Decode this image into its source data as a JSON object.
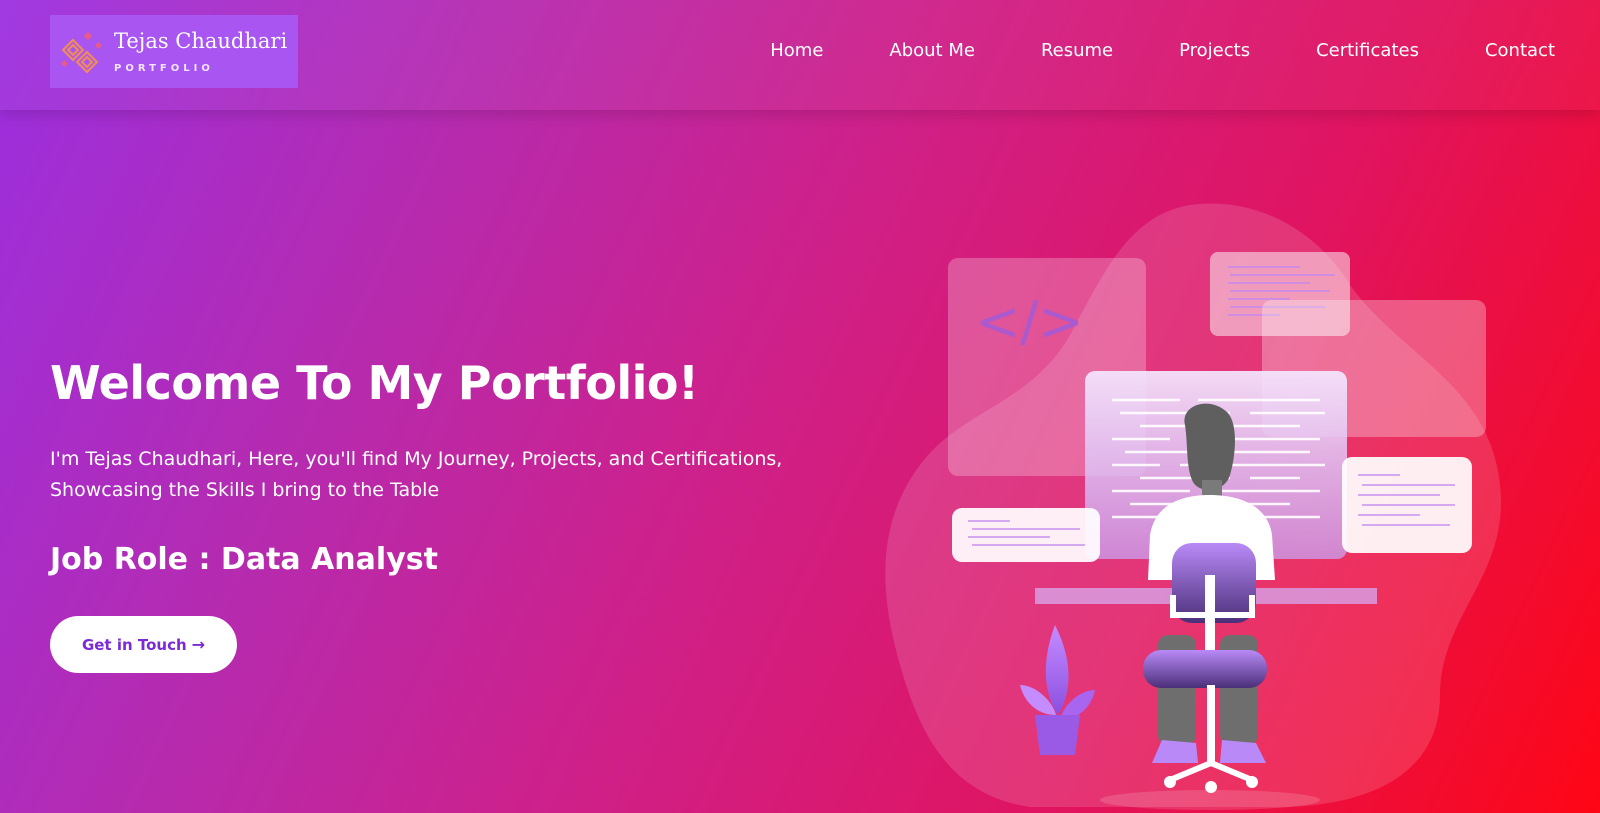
{
  "header": {
    "logo": {
      "name": "Tejas Chaudhari",
      "tagline": "PORTFOLIO",
      "icon": "diamond-pattern-icon"
    },
    "nav": [
      {
        "label": "Home"
      },
      {
        "label": "About Me"
      },
      {
        "label": "Resume"
      },
      {
        "label": "Projects"
      },
      {
        "label": "Certificates"
      },
      {
        "label": "Contact"
      }
    ]
  },
  "hero": {
    "title": "Welcome To My Portfolio!",
    "description": "I'm Tejas Chaudhari, Here, you'll find My Journey, Projects, and Certifications, Showcasing the Skills I bring to the Table",
    "role": "Job Role : Data Analyst",
    "cta_label": "Get in Touch",
    "cta_icon": "arrow-right-icon",
    "illustration": {
      "code_tag": "</>",
      "subject": "developer-at-desk-illustration"
    }
  },
  "colors": {
    "gradient_start": "#9b2fe0",
    "gradient_mid": "#cf2088",
    "gradient_end": "#ff0515",
    "logo_bg": "#a855f2",
    "cta_text": "#7a2bd6",
    "accent_purple": "#b97bf5"
  }
}
